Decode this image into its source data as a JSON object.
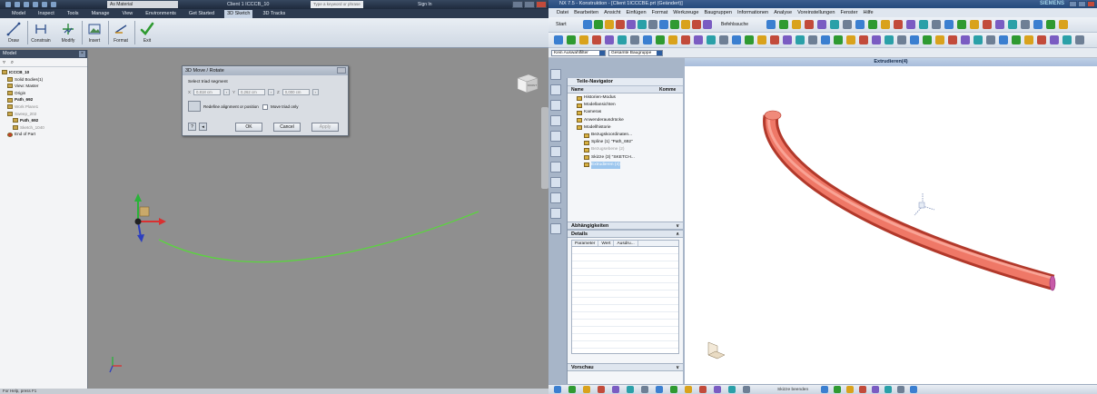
{
  "inventor": {
    "title_material": "As Material",
    "title_doc": "Client 1   ICCCB_10",
    "search_placeholder": "Type a keyword or phrase",
    "sign_in": "Sign In",
    "tabs": [
      "Model",
      "Inspect",
      "Tools",
      "Manage",
      "View",
      "Environments",
      "Get Started",
      "3D Sketch",
      "3D Tracks"
    ],
    "active_tab": "3D Sketch",
    "ribbon": {
      "draw": "Draw",
      "constrain": "Constrain",
      "modify": "Modify",
      "insert": "Insert",
      "format": "Format",
      "exit": "Exit"
    },
    "browser": {
      "header": "Model",
      "items": [
        {
          "label": "ICCCB_10",
          "cls": "b",
          "indent": 0
        },
        {
          "label": "Solid Bodies(1)",
          "cls": "",
          "indent": 1
        },
        {
          "label": "View: Master",
          "cls": "",
          "indent": 1
        },
        {
          "label": "Origin",
          "cls": "",
          "indent": 1
        },
        {
          "label": "Path_692",
          "cls": "b",
          "indent": 1
        },
        {
          "label": "Work Plane1",
          "cls": "g",
          "indent": 1
        },
        {
          "label": "Sweep_202",
          "cls": "g",
          "indent": 1
        },
        {
          "label": "Path_692",
          "cls": "b",
          "indent": 2
        },
        {
          "label": "Sketch_1040",
          "cls": "g",
          "indent": 2
        },
        {
          "label": "End of Part",
          "cls": "end",
          "indent": 1
        }
      ]
    },
    "viewcube_label": "FRONT",
    "status": "For Help, press F1",
    "dialog": {
      "title": "3D Move / Rotate",
      "select_label": "Select triad segment",
      "x_label": "X",
      "x_value": "0,818 cm",
      "y_label": "Y",
      "y_value": "0,262 cm",
      "z_label": "Z",
      "z_value": "0,000 cm",
      "redefine": "Redefine alignment or position",
      "move_triad_only": "Move triad only",
      "ok": "OK",
      "cancel": "Cancel",
      "apply": "Apply",
      "help_glyph": "?",
      "back_glyph": "◂"
    }
  },
  "nx": {
    "title": "NX 7.5 - Konstruktion - [Client 1ICCCBE.prt (Geändert)]",
    "brand": "SIEMENS",
    "menu": [
      "Datei",
      "Bearbeiten",
      "Ansicht",
      "Einfügen",
      "Format",
      "Werkzeuge",
      "Baugruppen",
      "Informationen",
      "Analyse",
      "Voreinstellungen",
      "Fenster",
      "Hilfe"
    ],
    "start": "Start",
    "command_search": "Befehlssuche",
    "filter_none": "Kein Auswahlfilter",
    "filter_assembly": "Gesamte Baugruppe",
    "feature_header": "Extrudieren(4)",
    "navigator": {
      "title": "Teile-Navigator",
      "col_name": "Name",
      "col_comment": "Komme",
      "items": [
        {
          "label": "Historien-Modus",
          "lvl": "i1",
          "cls": ""
        },
        {
          "label": "Modellansichten",
          "lvl": "i1",
          "cls": ""
        },
        {
          "label": "Kameras",
          "lvl": "i1",
          "cls": ""
        },
        {
          "label": "Anwenderausdrücke",
          "lvl": "i1",
          "cls": ""
        },
        {
          "label": "Modellhistorie",
          "lvl": "i1",
          "cls": ""
        },
        {
          "label": "Bezugskoordinaten...",
          "lvl": "i2",
          "cls": ""
        },
        {
          "label": "Spline (1) \"Path_692\"",
          "lvl": "i2",
          "cls": ""
        },
        {
          "label": "Bezugsebene (2)",
          "lvl": "i2",
          "cls": "g"
        },
        {
          "label": "Skizze (3) \"SKETCH...",
          "lvl": "i2",
          "cls": ""
        },
        {
          "label": "Extrudieren (4)",
          "lvl": "i2",
          "cls": "sel"
        }
      ],
      "dependencies": "Abhängigkeiten",
      "details": "Details",
      "detail_cols": [
        "Parameter",
        "Wert",
        "Ausdru..."
      ],
      "preview": "Vorschau",
      "chevron": "∨"
    },
    "sketch_tool": "Skizze beenden"
  }
}
